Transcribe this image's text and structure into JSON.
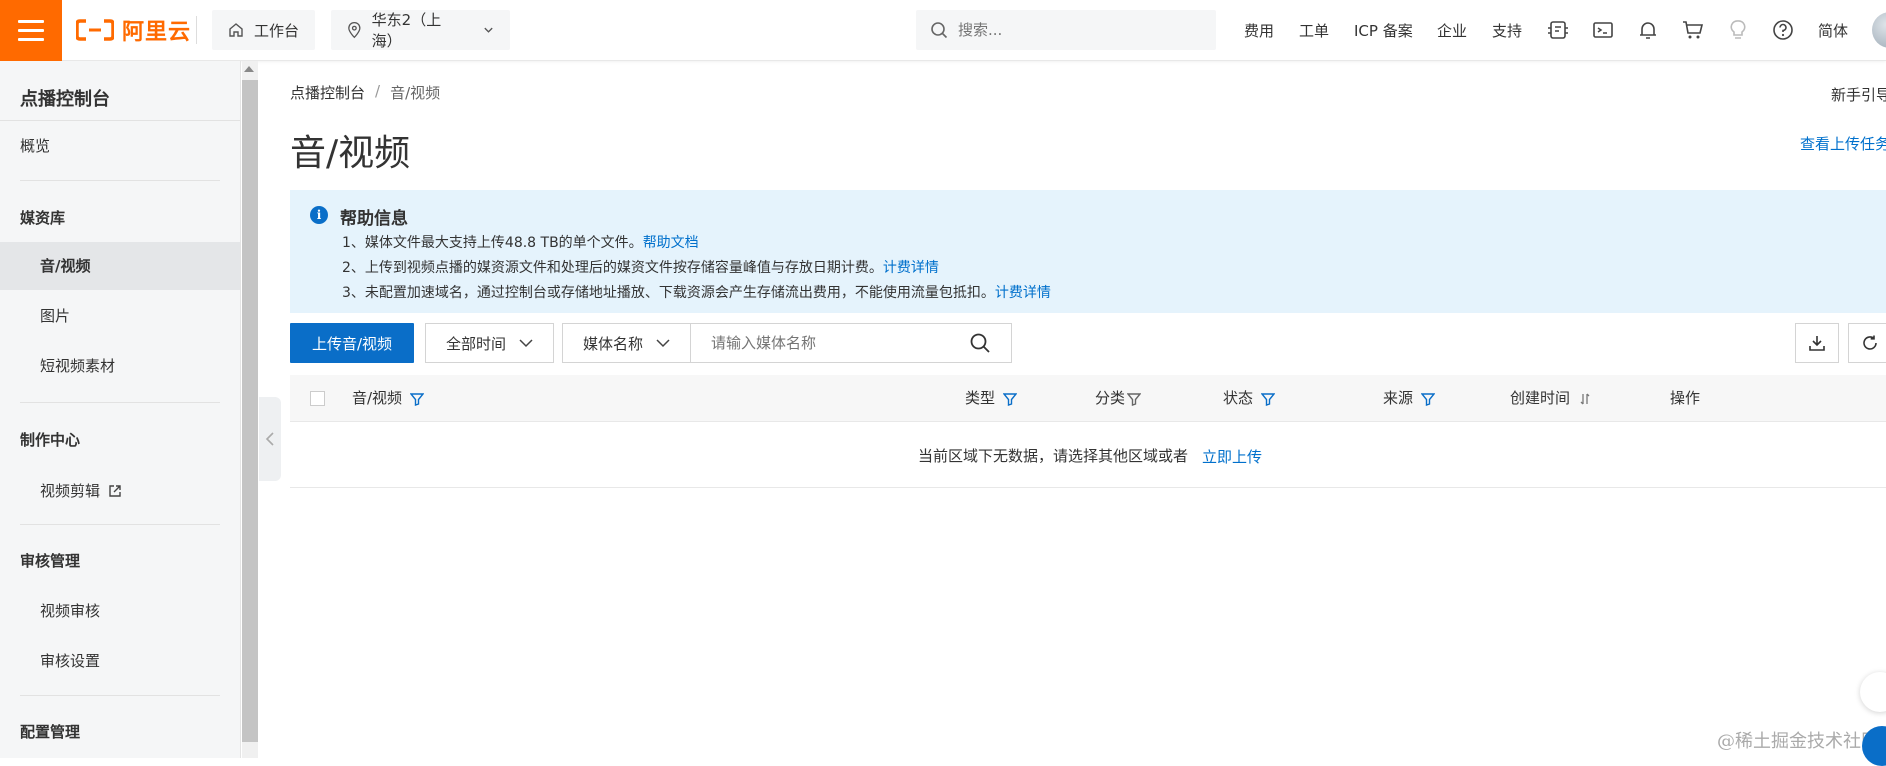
{
  "brand": {
    "logo_text": "阿里云",
    "logo_color": "#ff6a00"
  },
  "topbar": {
    "workbench": "工作台",
    "region": "华东2（上海）",
    "search_placeholder": "搜索...",
    "nav": [
      "费用",
      "工单",
      "ICP 备案",
      "企业",
      "支持"
    ],
    "lang": "简体",
    "icons": [
      "app-icon",
      "terminal-icon",
      "bell-icon",
      "cart-icon",
      "bulb-icon",
      "help-icon"
    ]
  },
  "sidebar": {
    "title": "点播控制台",
    "overview": "概览",
    "groups": [
      {
        "title": "媒资库",
        "items": [
          "音/视频",
          "图片",
          "短视频素材"
        ]
      },
      {
        "title": "制作中心",
        "items": [
          "视频剪辑"
        ]
      },
      {
        "title": "审核管理",
        "items": [
          "视频审核",
          "审核设置"
        ]
      },
      {
        "title": "配置管理",
        "items": []
      }
    ],
    "active_item": "音/视频"
  },
  "breadcrumb": {
    "root": "点播控制台",
    "sep": "/",
    "current": "音/视频"
  },
  "header": {
    "newbie": "新手引导",
    "title": "音/视频",
    "view_upload": "查看上传任务"
  },
  "help": {
    "title": "帮助信息",
    "lines": [
      {
        "text": "1、媒体文件最大支持上传48.8 TB的单个文件。",
        "link": "帮助文档"
      },
      {
        "text": "2、上传到视频点播的媒资源文件和处理后的媒资文件按存储容量峰值与存放日期计费。",
        "link": "计费详情"
      },
      {
        "text": "3、未配置加速域名，通过控制台或存储地址播放、下载资源会产生存储流出费用，不能使用流量包抵扣。",
        "link": "计费详情"
      }
    ]
  },
  "toolbar": {
    "upload": "上传音/视频",
    "time_filter": "全部时间",
    "field_filter": "媒体名称",
    "search_placeholder": "请输入媒体名称"
  },
  "table": {
    "columns": [
      "音/视频",
      "类型",
      "分类",
      "状态",
      "来源",
      "创建时间",
      "操作"
    ],
    "empty_text": "当前区域下无数据，请选择其他区域或者",
    "empty_link": "立即上传"
  },
  "watermark": "@稀土掘金技术社区",
  "colors": {
    "primary": "#0a6ec8",
    "link": "#0070cc",
    "help_bg": "#e5f3fc"
  }
}
